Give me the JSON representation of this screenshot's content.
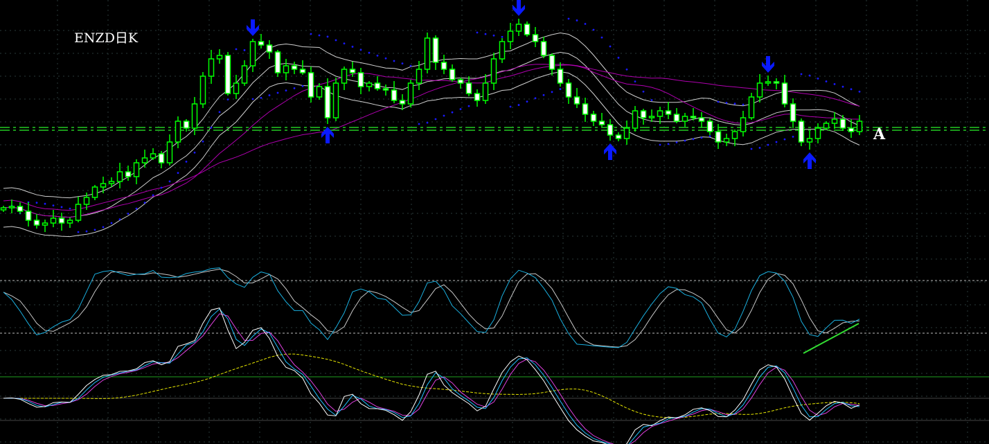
{
  "chart_data": {
    "type": "candlestick",
    "title": "ENZD日K",
    "annotation_label": "A",
    "price_unit": "relative",
    "closes": [
      70,
      72,
      65,
      52,
      45,
      48,
      55,
      48,
      52,
      75,
      85,
      100,
      105,
      108,
      122,
      115,
      135,
      142,
      148,
      135,
      165,
      195,
      185,
      220,
      260,
      285,
      290,
      235,
      250,
      275,
      310,
      305,
      295,
      265,
      275,
      270,
      265,
      230,
      245,
      200,
      250,
      270,
      265,
      245,
      250,
      242,
      240,
      225,
      220,
      250,
      270,
      315,
      280,
      270,
      255,
      250,
      235,
      225,
      250,
      285,
      310,
      325,
      335,
      320,
      310,
      290,
      270,
      250,
      230,
      220,
      205,
      195,
      190,
      175,
      170,
      185,
      210,
      200,
      202,
      210,
      205,
      195,
      202,
      200,
      195,
      180,
      165,
      170,
      180,
      200,
      230,
      250,
      252,
      250,
      220,
      195,
      165,
      170,
      185,
      192,
      198,
      185,
      180,
      195
    ],
    "horizontal_levels": [
      186,
      182
    ],
    "sell_signals_at_candle": [
      30,
      62,
      92
    ],
    "buy_signals_at_candle": [
      39,
      73,
      97
    ],
    "stochastic": {
      "period": 9,
      "smooth": 3,
      "levels": [
        80,
        20
      ]
    },
    "oscillator_panel": {
      "reference_line": 0
    },
    "colors": {
      "background": "#000000",
      "candle": "#00ff00",
      "down_fill": "#ffffff",
      "band": "#d0d0d0",
      "ma_long": "#b000b0",
      "sar": "#1a1aff",
      "arrow": "#0a1aff",
      "level": "#22cc22",
      "k": "#1ab0e0",
      "d": "#c8c8c8",
      "osc1": "#ffffff",
      "osc2": "#20c0ff",
      "osc3": "#e040e0",
      "osc4": "#e8e800",
      "trendline": "#33dd33"
    }
  }
}
